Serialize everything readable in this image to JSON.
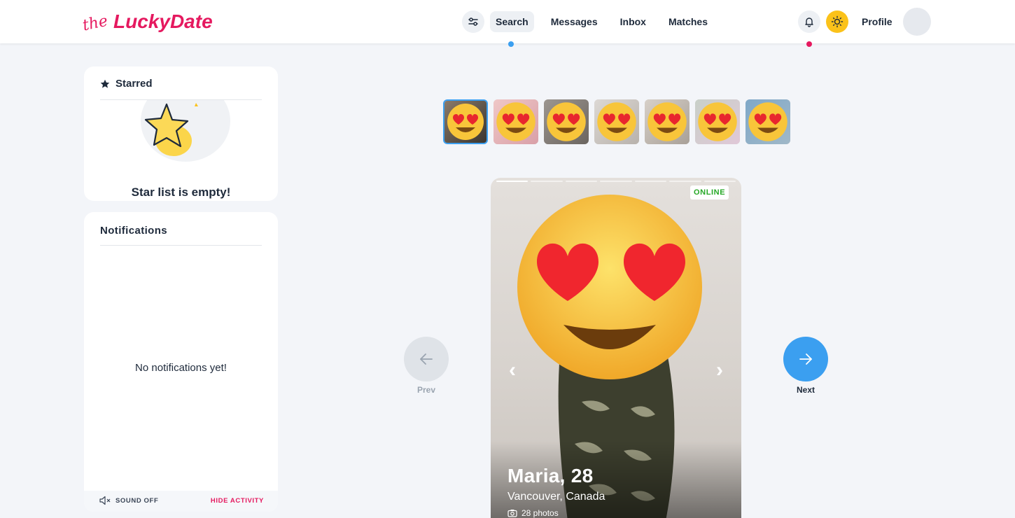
{
  "header": {
    "logo_prefix": "the",
    "logo_name": "LuckyDate",
    "nav": [
      {
        "label": "Search",
        "active": true
      },
      {
        "label": "Messages",
        "active": false
      },
      {
        "label": "Inbox",
        "active": false
      },
      {
        "label": "Matches",
        "active": false
      }
    ],
    "profile_label": "Profile"
  },
  "starred": {
    "title": "Starred",
    "empty_text": "Star list is empty!"
  },
  "notifications": {
    "title": "Notifications",
    "empty_text": "No notifications yet!",
    "sound_label": "SOUND OFF",
    "hide_label": "HIDE ACTIVITY"
  },
  "profile_card": {
    "status": "ONLINE",
    "name_age": "Maria, 28",
    "location": "Vancouver, Canada",
    "photos_label": "28 photos",
    "thumbnail_count": 7
  },
  "navigation": {
    "prev_label": "Prev",
    "next_label": "Next"
  },
  "colors": {
    "brand": "#e5195f",
    "accent": "#3b9ff0",
    "online": "#26a826",
    "sun": "#fbc21a"
  }
}
